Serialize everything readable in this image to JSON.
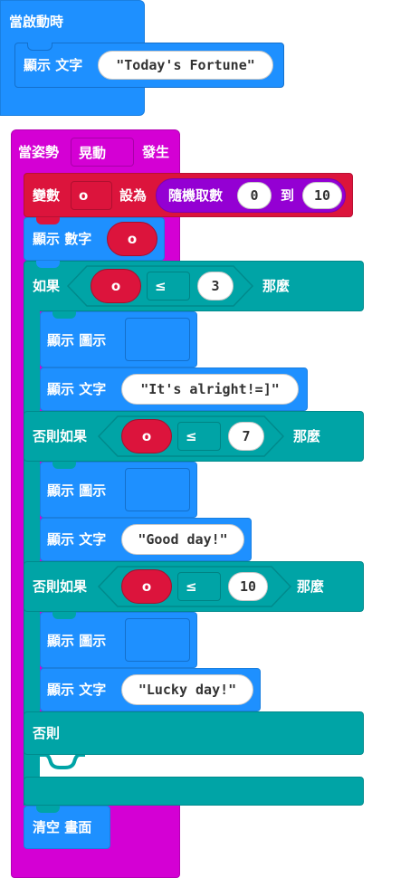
{
  "on_start": {
    "hat_label": "當啟動時",
    "show_string_label": "顯示 文字",
    "string_value": "\"Today's Fortune\""
  },
  "on_gesture": {
    "hat_label": "當姿勢",
    "gesture_option": "晃動",
    "hat_suffix": "發生",
    "set_label": "變數",
    "var_name": "o",
    "set_to_label": "設為",
    "random_label": "隨機取數",
    "random_from": "0",
    "random_to_label": "到",
    "random_to": "10",
    "show_number_label": "顯示 數字",
    "show_number_var": "o",
    "if_label": "如果",
    "then_label": "那麼",
    "else_if_label": "否則如果",
    "else_label": "否則",
    "compare_op": "≤",
    "cond1_value": "3",
    "cond2_value": "7",
    "cond3_value": "10",
    "show_icon_label": "顯示 圖示",
    "show_string_label": "顯示 文字",
    "msg1": "\"It's alright!=]\"",
    "msg2": "\"Good day!\"",
    "msg3": "\"Lucky day!\"",
    "clear_label": "清空 畫面"
  },
  "colors": {
    "basic": "#1e90ff",
    "input": "#d400d4",
    "variables": "#dc143c",
    "math": "#9400d3",
    "logic": "#00a4a6"
  }
}
